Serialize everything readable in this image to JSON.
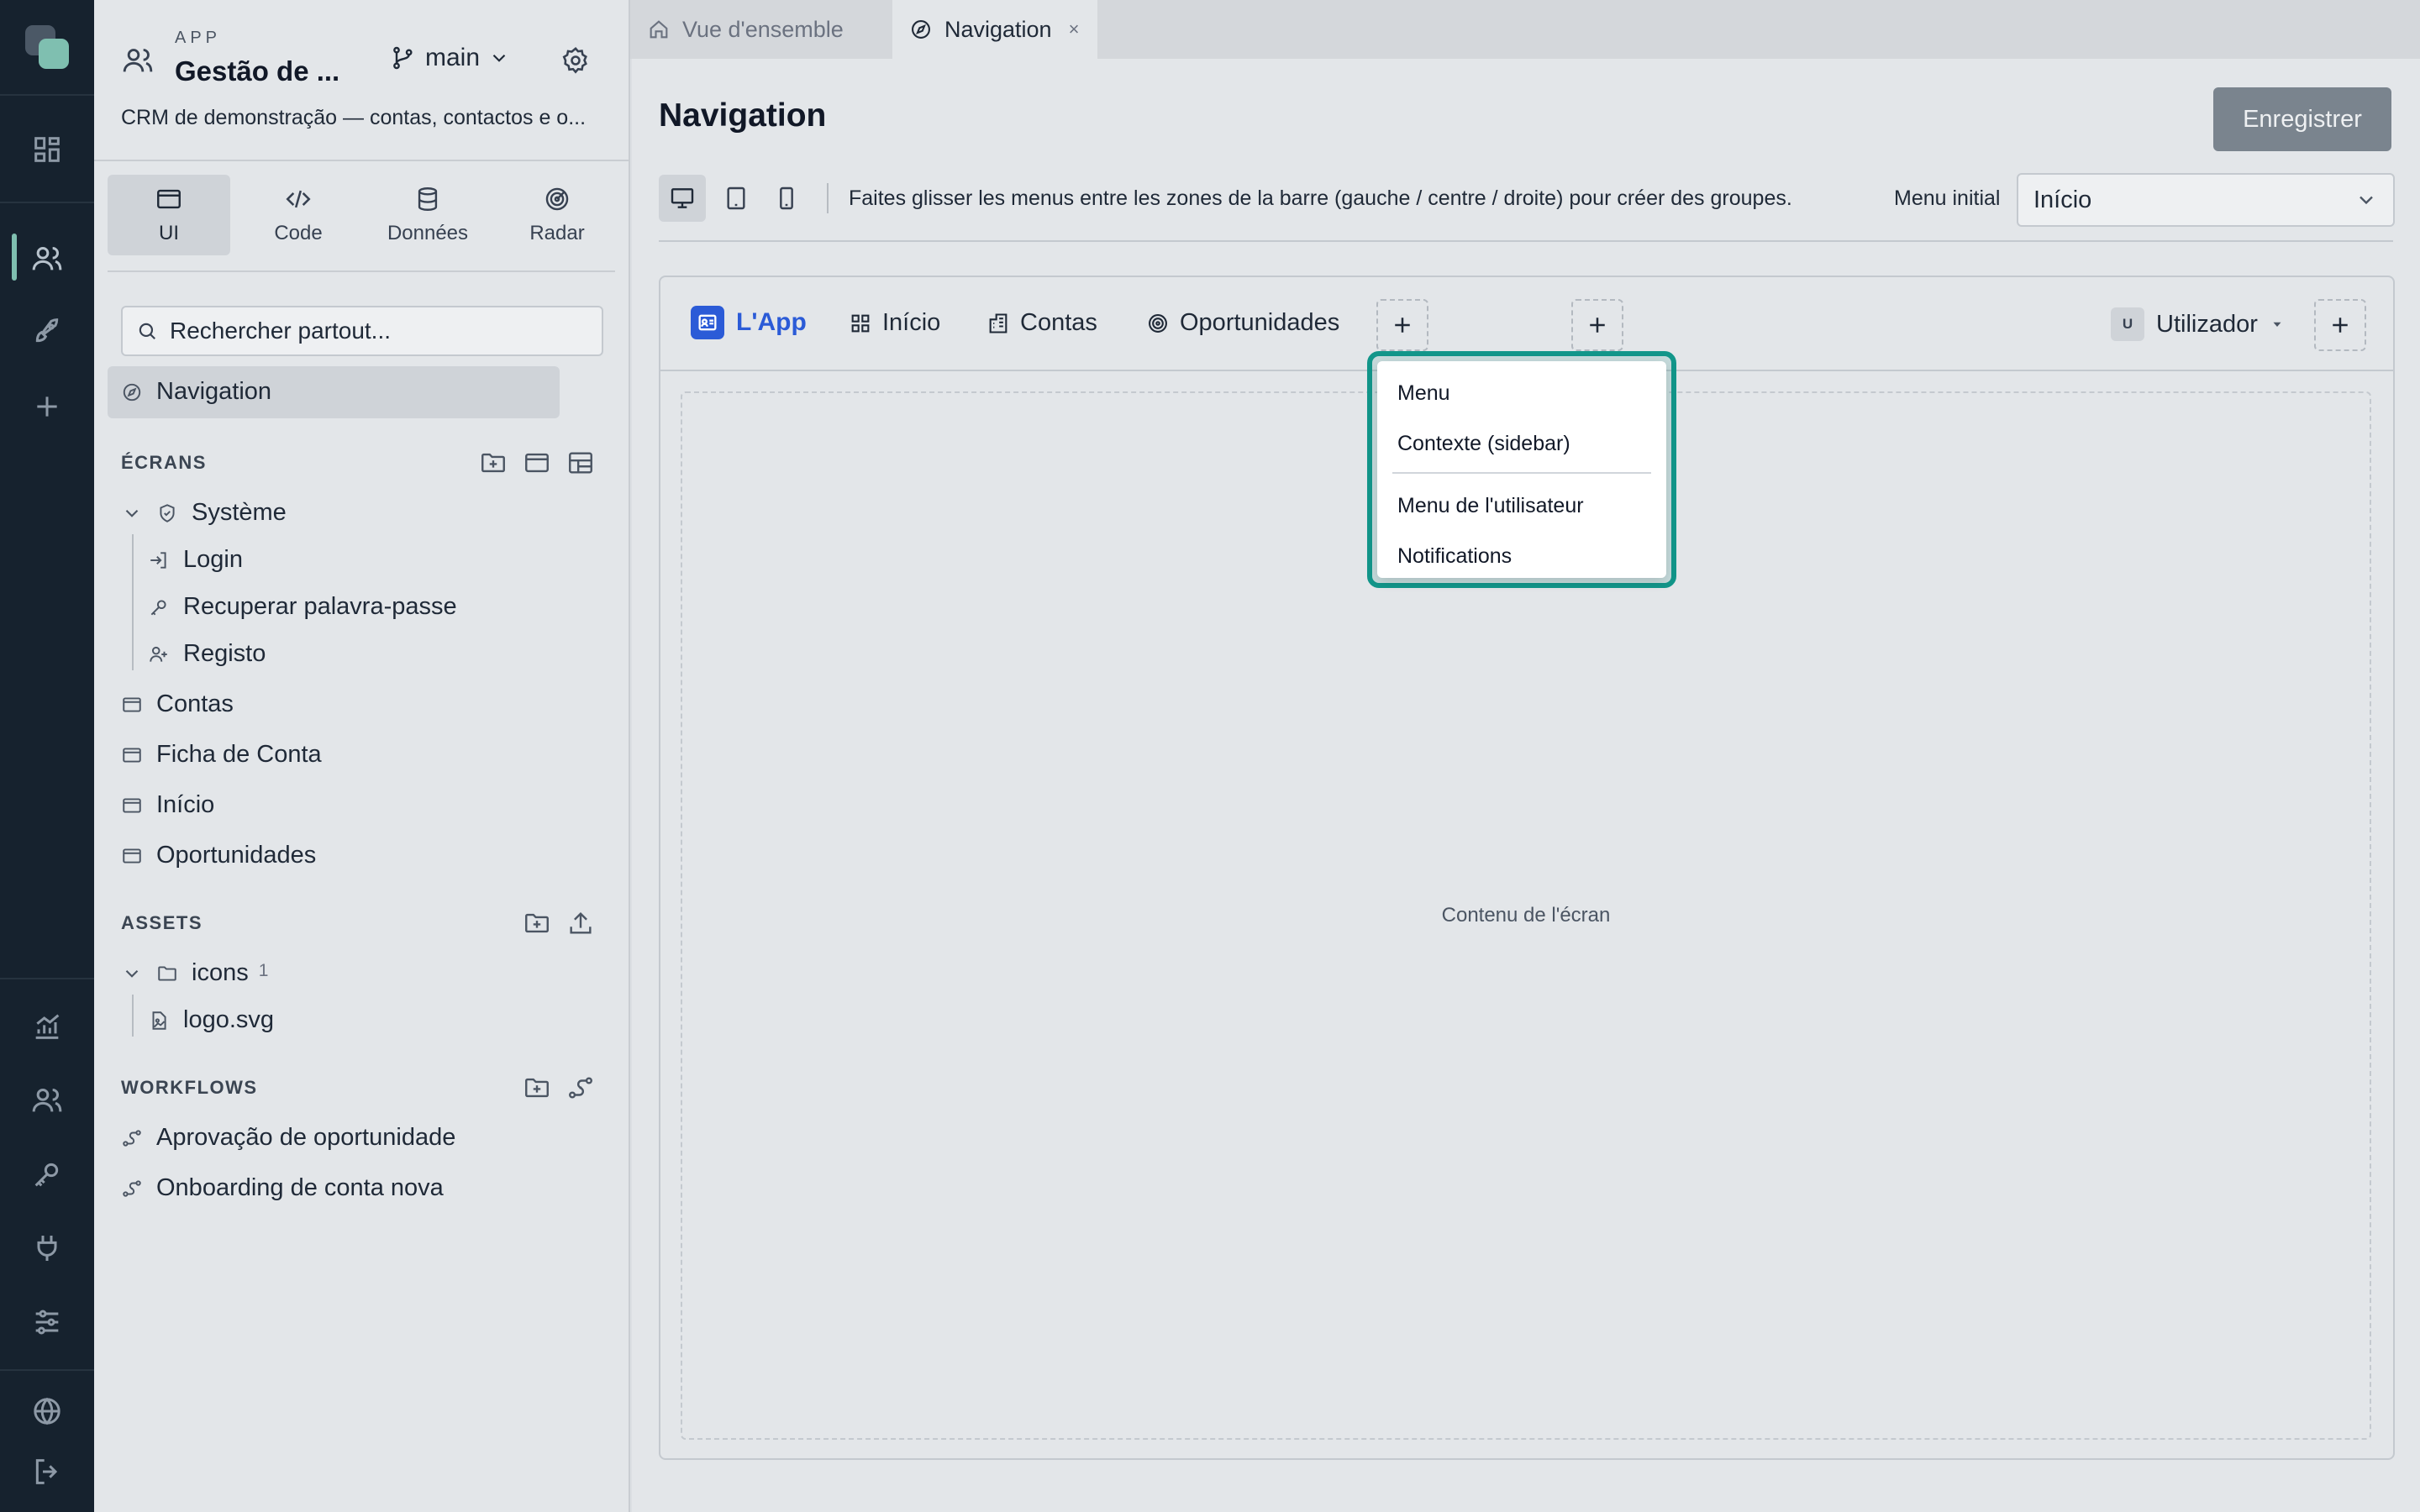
{
  "app": {
    "kicker": "APP",
    "title": "Gestão de ...",
    "branch": "main",
    "description": "CRM de demonstração — contas, contactos e o..."
  },
  "mode_tabs": [
    {
      "label": "UI",
      "icon": "window-icon"
    },
    {
      "label": "Code",
      "icon": "code-icon"
    },
    {
      "label": "Données",
      "icon": "database-icon"
    },
    {
      "label": "Radar",
      "icon": "radar-icon"
    }
  ],
  "search": {
    "placeholder": "Rechercher partout..."
  },
  "selected_item": "Navigation",
  "sections": {
    "screens": "ÉCRANS",
    "assets": "ASSETS",
    "workflows": "WORKFLOWS"
  },
  "screens": {
    "group": "Système",
    "system_items": [
      "Login",
      "Recuperar palavra-passe",
      "Registo"
    ],
    "items": [
      "Contas",
      "Ficha de Conta",
      "Início",
      "Oportunidades"
    ]
  },
  "assets": {
    "folder": "icons",
    "count": "1",
    "file": "logo.svg"
  },
  "workflows": [
    "Aprovação de oportunidade",
    "Onboarding de conta nova"
  ],
  "editor_tabs": [
    {
      "label": "Vue d'ensemble"
    },
    {
      "label": "Navigation",
      "close": "×"
    }
  ],
  "page": {
    "title": "Navigation",
    "save_button": "Enregistrer",
    "hint": "Faites glisser les menus entre les zones de la barre (gauche / centre / droite) pour créer des groupes.",
    "initial_menu_label": "Menu initial",
    "initial_menu_value": "Início"
  },
  "preview": {
    "brand": "L'App",
    "nav": [
      "Início",
      "Contas",
      "Oportunidades"
    ],
    "user_initial": "U",
    "user_label": "Utilizador",
    "content_placeholder": "Contenu de l'écran"
  },
  "dropdown": {
    "items": [
      "Menu",
      "Contexte (sidebar)",
      "Menu de l'utilisateur",
      "Notifications"
    ]
  },
  "colors": {
    "rail": "#16222e",
    "accent": "#12968a",
    "brand": "#2b5bd7",
    "save_button": "#7a848e"
  }
}
